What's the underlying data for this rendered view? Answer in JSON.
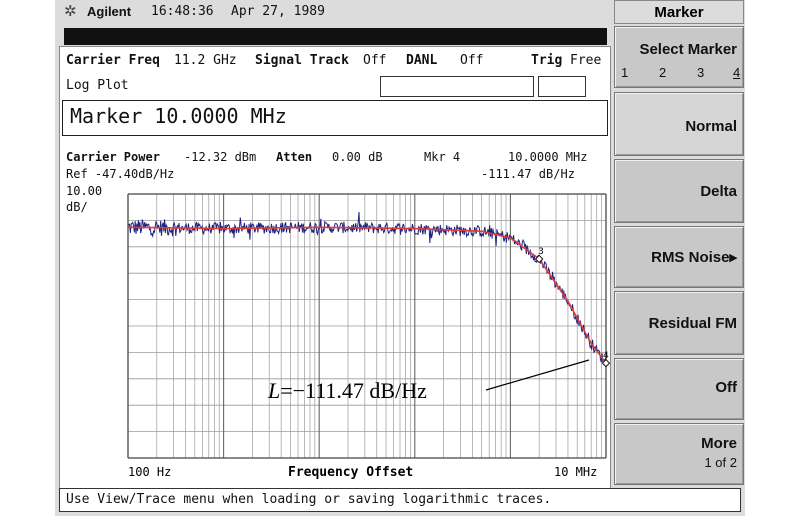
{
  "header": {
    "brand": "Agilent",
    "time": "16:48:36",
    "date": "Apr 27, 1989"
  },
  "status": {
    "carrier_freq_label": "Carrier Freq",
    "carrier_freq_value": "11.2 GHz",
    "signal_track_label": "Signal Track",
    "signal_track_value": "Off",
    "danl_label": "DANL",
    "danl_value": "Off",
    "trig_label": "Trig",
    "trig_value": "Free",
    "plot_mode": "Log Plot"
  },
  "marker_readout": "Marker 10.0000 MHz",
  "measurement": {
    "carrier_power_label": "Carrier Power",
    "carrier_power_value": "-12.32 dBm",
    "atten_label": "Atten",
    "atten_value": "0.00 dB",
    "mkr_label": "Mkr 4",
    "mkr_freq": "10.0000 MHz",
    "ref": "Ref -47.40dB/Hz",
    "mkr_value": "-111.47 dB/Hz",
    "scale_value": "10.00",
    "scale_unit": "dB/"
  },
  "plot": {
    "x_start": "100 Hz",
    "x_title": "Frequency Offset",
    "x_stop": "10 MHz",
    "annotation_italic": "L",
    "annotation_rest": "=−111.47 dB/Hz",
    "marker_3": "3",
    "marker_4": "4",
    "trace_color": "#1a237e",
    "smooth_color": "#e53935"
  },
  "chart_data": {
    "type": "line",
    "x_scale": "log",
    "xlim": [
      100,
      10000000
    ],
    "ylim": [
      -147.4,
      -47.4
    ],
    "y_per_div_db": 10,
    "series": [
      {
        "x": [
          100,
          1000,
          10000,
          100000,
          500000,
          1000000,
          2000000,
          4000000,
          7000000,
          10000000
        ],
        "y": [
          -60,
          -60.5,
          -60,
          -60.5,
          -61.5,
          -64,
          -72,
          -88,
          -104,
          -111.47
        ]
      }
    ]
  },
  "softkeys": {
    "title": "Marker",
    "select_marker": "Select Marker",
    "select_nums": [
      "1",
      "2",
      "3",
      "4"
    ],
    "normal": "Normal",
    "delta": "Delta",
    "rms_noise": "RMS Noise▸",
    "residual_fm": "Residual FM",
    "off": "Off",
    "more": "More",
    "more_page": "1 of 2"
  },
  "message": "Use View/Trace menu when loading or saving logarithmic traces."
}
